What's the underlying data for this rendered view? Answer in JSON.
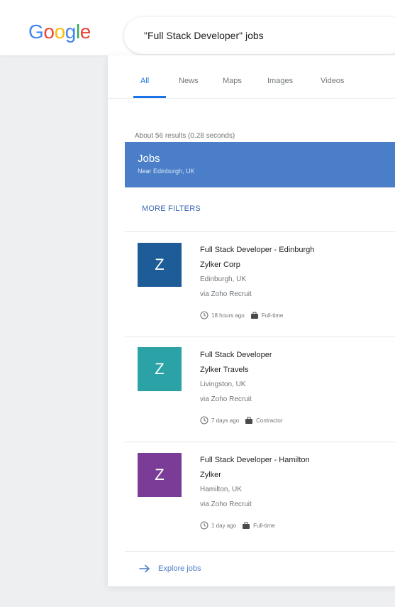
{
  "header": {
    "logo": {
      "letters": [
        "G",
        "o",
        "o",
        "g",
        "l",
        "e"
      ],
      "colors": [
        "#4285f4",
        "#ea4335",
        "#fbbc05",
        "#4285f4",
        "#34a853",
        "#ea4335"
      ]
    },
    "search_query": "\"Full Stack Developer\" jobs"
  },
  "tabs": [
    {
      "label": "All",
      "active": true
    },
    {
      "label": "News",
      "active": false
    },
    {
      "label": "Maps",
      "active": false
    },
    {
      "label": "Images",
      "active": false
    },
    {
      "label": "Videos",
      "active": false
    }
  ],
  "result_stats": "About 56 results (0.28 seconds)",
  "jobs_card": {
    "title": "Jobs",
    "subtitle": "Near Edinburgh, UK",
    "more_filters": "MORE FILTERS",
    "header_color": "#4a7ec8",
    "accent_color": "#3a69b5",
    "jobs": [
      {
        "logo_letter": "Z",
        "logo_color": "#1d5c96",
        "title": "Full Stack Developer - Edinburgh",
        "company": "Zylker Corp",
        "location": "Edinburgh, UK",
        "source": "via Zoho Recruit",
        "posted": "18 hours ago",
        "type": "Full-time",
        "time_icon": "clock-icon",
        "type_icon": "briefcase-icon"
      },
      {
        "logo_letter": "Z",
        "logo_color": "#2aa2a6",
        "title": "Full Stack Developer",
        "company": "Zylker Travels",
        "location": "Livingston, UK",
        "source": "via Zoho Recruit",
        "posted": "7 days ago",
        "type": "Contractor",
        "time_icon": "clock-icon",
        "type_icon": "briefcase-icon"
      },
      {
        "logo_letter": "Z",
        "logo_color": "#7a3c96",
        "title": "Full Stack Developer - Hamilton",
        "company": "Zylker",
        "location": "Hamilton, UK",
        "source": "via Zoho Recruit",
        "posted": "1 day ago",
        "type": "Full-time",
        "time_icon": "clock-icon",
        "type_icon": "briefcase-icon"
      }
    ],
    "explore": {
      "label": "Explore jobs",
      "icon": "arrow-right-icon"
    }
  }
}
